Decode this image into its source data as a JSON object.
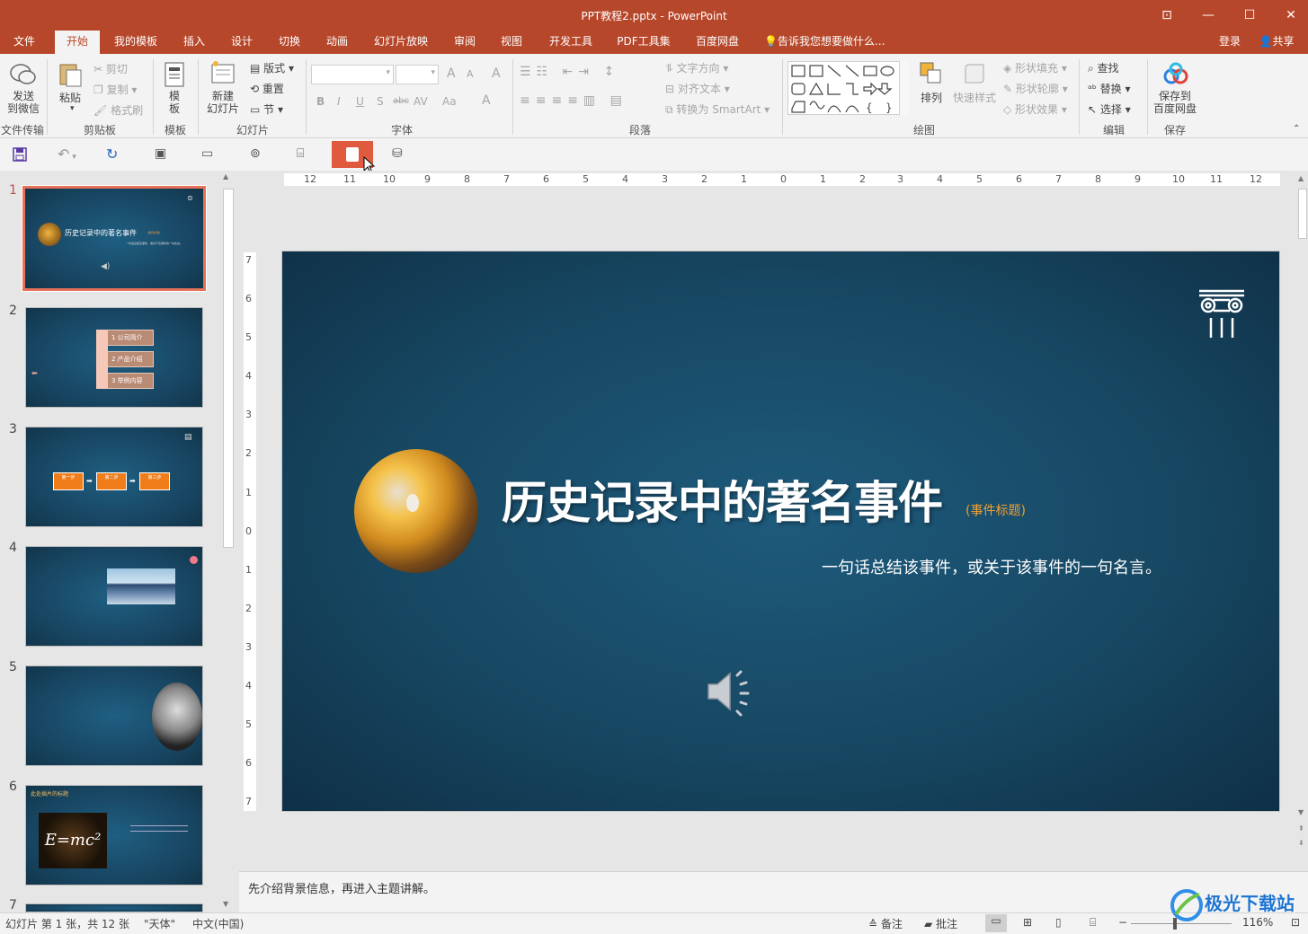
{
  "window": {
    "title": "PPT教程2.pptx - PowerPoint",
    "controls": {
      "ribbon_display": "⊡",
      "minimize": "—",
      "maximize": "☐",
      "close": "✕"
    }
  },
  "menu": {
    "tabs": [
      "文件",
      "开始",
      "我的模板",
      "插入",
      "设计",
      "切换",
      "动画",
      "幻灯片放映",
      "审阅",
      "视图",
      "开发工具",
      "PDF工具集",
      "百度网盘"
    ],
    "active_tab": "开始",
    "tell_me": "告诉我您想要做什么...",
    "login": "登录",
    "share": "共享"
  },
  "ribbon": {
    "file_transfer": {
      "button": "发送\n到微信",
      "label": "文件传输"
    },
    "clipboard": {
      "paste": "粘贴",
      "cut": "剪切",
      "copy": "复制",
      "format_painter": "格式刷",
      "label": "剪贴板"
    },
    "template": {
      "button": "模\n板",
      "label": "模板"
    },
    "slides": {
      "new_slide": "新建\n幻灯片",
      "layout": "版式",
      "reset": "重置",
      "section": "节",
      "label": "幻灯片"
    },
    "font": {
      "label": "字体",
      "bold": "B",
      "italic": "I",
      "underline": "U",
      "shadow": "S",
      "strike": "abc",
      "spacing": "AV",
      "case": "Aa",
      "grow": "A",
      "shrink": "A",
      "clear": "A",
      "color": "A"
    },
    "paragraph": {
      "text_direction": "文字方向",
      "align_text": "对齐文本",
      "smartart": "转换为 SmartArt",
      "label": "段落"
    },
    "drawing": {
      "arrange": "排列",
      "quick_styles": "快速样式",
      "shape_fill": "形状填充",
      "shape_outline": "形状轮廓",
      "shape_effects": "形状效果",
      "label": "绘图"
    },
    "editing": {
      "find": "查找",
      "replace": "替换",
      "select": "选择",
      "label": "编辑"
    },
    "save": {
      "button": "保存到\n百度网盘",
      "label": "保存"
    }
  },
  "slides_panel": {
    "numbers": [
      "1",
      "2",
      "3",
      "4",
      "5",
      "6",
      "7"
    ],
    "slide1": {
      "title": "历史记录中的著名事件",
      "tag": "(事件标题)",
      "sub": "一句话总结该事件，或关于该事件的一句名言。"
    },
    "slide2": {
      "items": [
        "1 公司简介",
        "2 产品介绍",
        "3 举例内容"
      ]
    },
    "slide3": {
      "steps": [
        "第一步",
        "第二步",
        "第三步"
      ]
    },
    "slide6": {
      "title": "此处插片的标题",
      "formula": "E=mc²"
    }
  },
  "slide": {
    "title": "历史记录中的著名事件",
    "title_tag": "(事件标题)",
    "subtitle": "一句话总结该事件，或关于该事件的一句名言。"
  },
  "rulers": {
    "h": [
      "12",
      "11",
      "10",
      "9",
      "8",
      "7",
      "6",
      "5",
      "4",
      "3",
      "2",
      "1",
      "0",
      "1",
      "2",
      "3",
      "4",
      "5",
      "6",
      "7",
      "8",
      "9",
      "10",
      "11",
      "12"
    ],
    "v": [
      "7",
      "6",
      "5",
      "4",
      "3",
      "2",
      "1",
      "0",
      "1",
      "2",
      "3",
      "4",
      "5",
      "6",
      "7"
    ]
  },
  "notes": {
    "text": "先介绍背景信息，再进入主题讲解。"
  },
  "status": {
    "slide_info": "幻灯片 第 1 张，共 12 张",
    "theme": "\"天体\"",
    "language": "中文(中国)",
    "notes_btn": "备注",
    "comments_btn": "批注",
    "zoom": "116%"
  },
  "watermark": {
    "text": "极光下载站"
  },
  "colors": {
    "accent": "#b7472a",
    "slide_bg": "#174863",
    "selected_border": "#e87259",
    "active_qat": "#e05a3e"
  }
}
